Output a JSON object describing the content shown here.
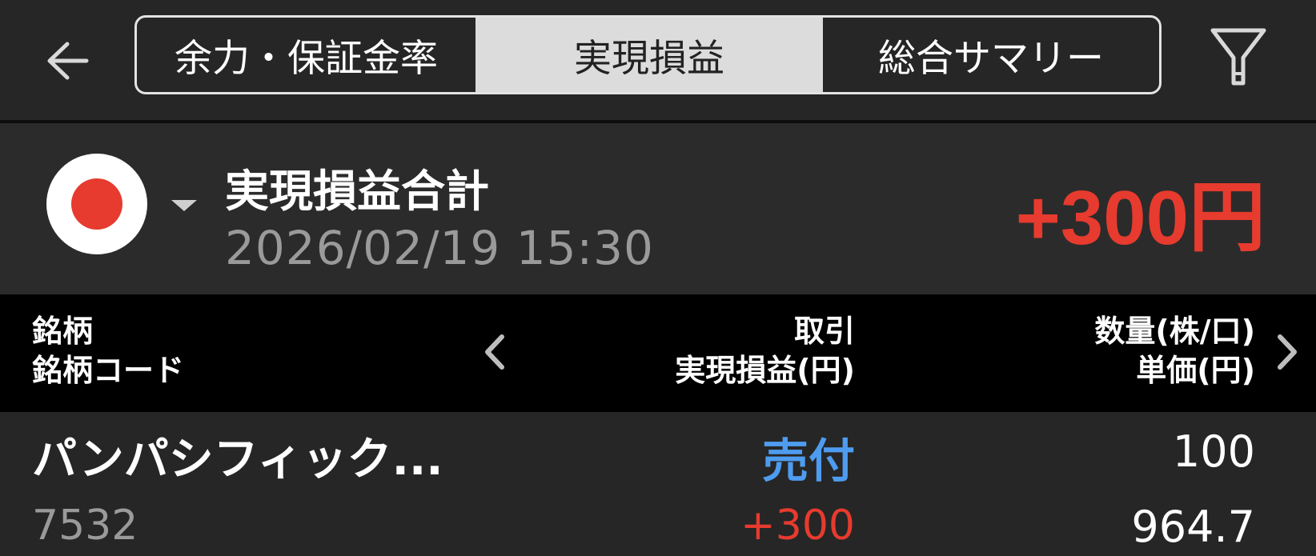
{
  "header": {
    "tabs": [
      {
        "label": "余力・保証金率",
        "selected": false
      },
      {
        "label": "実現損益",
        "selected": true
      },
      {
        "label": "総合サマリー",
        "selected": false
      }
    ],
    "icons": {
      "back": "arrow-left-icon",
      "filter": "filter-icon"
    }
  },
  "summary": {
    "market_flag": "japan-flag-icon",
    "title": "実現損益合計",
    "datetime": "2026/02/19  15:30",
    "total": "+300円"
  },
  "table": {
    "headers": {
      "col1_line1": "銘柄",
      "col1_line2": "銘柄コード",
      "col2_line1": "取引",
      "col2_line2": "実現損益(円)",
      "col3_line1": "数量(株/口)",
      "col3_line2": "単価(円)"
    },
    "rows": [
      {
        "name": "パンパシフィック...",
        "code": "7532",
        "trade": "売付",
        "realized_pl": "+300",
        "quantity": "100",
        "unit_price": "964.7"
      }
    ]
  },
  "colors": {
    "background": "#262626",
    "summary_background": "#2b2b2b",
    "header_row_background": "#000000",
    "positive": "#e63b2e",
    "sell": "#4e9cf0",
    "muted_text": "#9a9a9a",
    "selected_tab": "#dcdcdc"
  }
}
